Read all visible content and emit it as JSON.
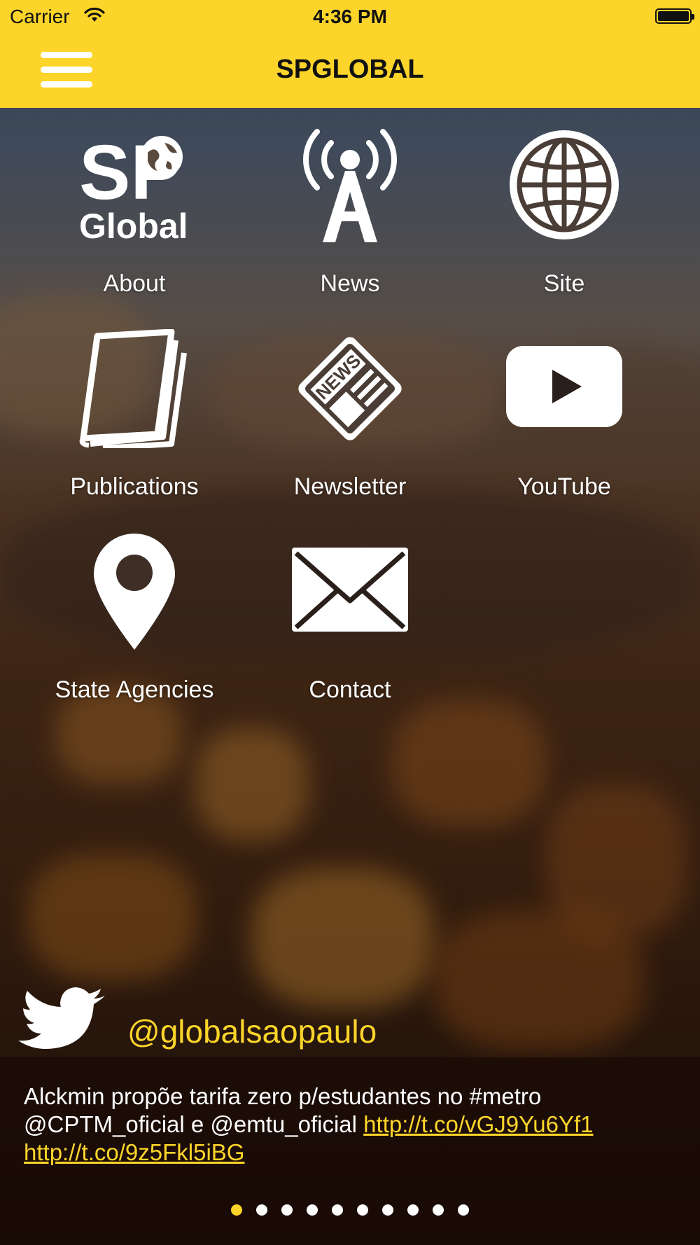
{
  "status_bar": {
    "carrier": "Carrier",
    "time": "4:36 PM"
  },
  "nav": {
    "title": "SPGLOBAL",
    "menu_icon": "hamburger-menu-icon"
  },
  "logo": {
    "sp": "SP",
    "global": "Global"
  },
  "grid": [
    {
      "label": "About",
      "icon": "sp-global-logo-icon"
    },
    {
      "label": "News",
      "icon": "radio-tower-icon"
    },
    {
      "label": "Site",
      "icon": "globe-icon"
    },
    {
      "label": "Publications",
      "icon": "magazines-icon"
    },
    {
      "label": "Newsletter",
      "icon": "newspaper-icon"
    },
    {
      "label": "YouTube",
      "icon": "youtube-play-icon"
    },
    {
      "label": "State Agencies",
      "icon": "map-pin-icon"
    },
    {
      "label": "Contact",
      "icon": "envelope-icon"
    }
  ],
  "newspaper_word": "NEWS",
  "twitter": {
    "handle": "@globalsaopaulo",
    "icon": "twitter-bird-icon",
    "tweet_text": "Alckmin propõe tarifa zero p/estudantes no #metro @CPTM_oficial e @emtu_oficial",
    "link1": "http://t.co/vGJ9Yu6Yf1",
    "link2": "http://t.co/9z5Fkl5iBG"
  },
  "pager": {
    "total": 10,
    "active_index": 0
  },
  "colors": {
    "accent": "#fdd52a",
    "icon": "#ffffff"
  }
}
